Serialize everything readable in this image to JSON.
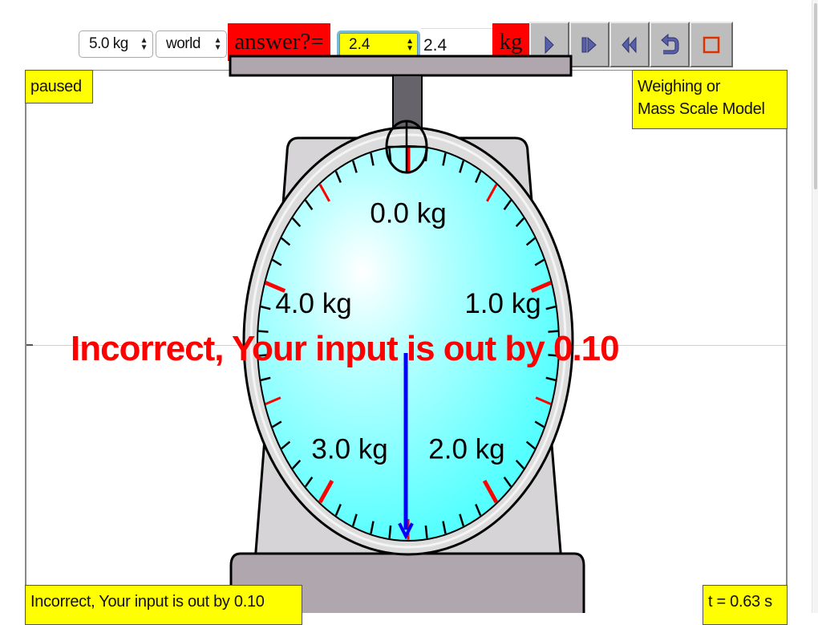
{
  "toolbar": {
    "mass_select": {
      "value": "5.0 kg"
    },
    "frame_select": {
      "value": "world"
    },
    "answer_label": "answer?=",
    "answer_select": {
      "value": "2.4"
    },
    "answer_input": {
      "value": "2.4"
    },
    "unit_label": "kg",
    "buttons": [
      {
        "name": "play",
        "icon": "play-icon"
      },
      {
        "name": "step",
        "icon": "step-forward-icon"
      },
      {
        "name": "rewind",
        "icon": "rewind-icon"
      },
      {
        "name": "reset",
        "icon": "reset-icon"
      },
      {
        "name": "clear",
        "icon": "square-icon"
      }
    ]
  },
  "status": {
    "state": "paused",
    "title_line1": "Weighing or",
    "title_line2": "Mass Scale Model",
    "feedback": "Incorrect, Your input is out by 0.10",
    "time": "t = 0.63 s"
  },
  "overlay_message": "Incorrect, Your input is out by 0.10",
  "dial": {
    "labels": [
      "0.0 kg",
      "1.0 kg",
      "2.0 kg",
      "3.0 kg",
      "4.0 kg"
    ],
    "max_kg": 5.0,
    "minor_step_kg": 0.1,
    "reading_kg": 2.5,
    "colors": {
      "face": "#66ffff",
      "major_tick": "#ff0000",
      "minor_tick": "#000000",
      "needle": "#0000ff"
    }
  },
  "colors": {
    "label_bg": "#ff0000",
    "info_bg": "#ffff00",
    "button_bg": "#bdbdbd",
    "scale_body": "#d6d4d6",
    "scale_base": "#b0a7ae",
    "stem": "#66636b"
  }
}
